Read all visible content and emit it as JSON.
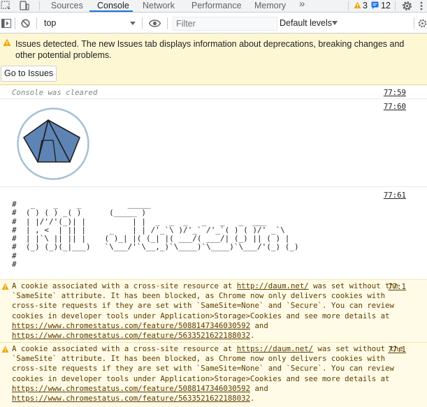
{
  "tabs": {
    "sources": "Sources",
    "console": "Console",
    "network": "Network",
    "performance": "Performance",
    "memory": "Memory",
    "more": "»"
  },
  "badges": {
    "warnings": "3",
    "messages": "12"
  },
  "toolbar": {
    "context": "top",
    "filter_placeholder": "Filter",
    "levels": "Default levels"
  },
  "banner": {
    "message": "Issues detected. The new Issues tab displays information about deprecations, breaking changes and other potential problems.",
    "button": "Go to Issues"
  },
  "logs": {
    "cleared": "Console was cleared",
    "cleared_ts": "77:59",
    "logo_ts": "77:60",
    "ascii_ts": "77:61",
    "ascii_art": "#   _    _    _          _____\n#  ( ) ( ) _( )      (_____ )\n#  | |/'/'(_)| |          | |  _  _  _   _   _   _  ___\n#  | , <  | || |     _    | | /'_`\\ )/'_` /'_`( ) ( )/' _`\\\n#  | |`\\ || || |    ( )_| |( (_| |( ___/( ___/| (_) || ( ) |\n#  (_) (_)(_|___)   `\\___/'`\\__,_)`\\____)`\\____)`\\___/'(_) (_)\n#\n#"
  },
  "warnings": [
    {
      "p1": "A cookie associated with a cross-site resource at ",
      "link1": "http://daum.net/",
      "p2": " was set without the `SameSite` attribute. It has been blocked, as Chrome now only delivers cookies with cross-site requests if they are set with `SameSite=None` and `Secure`. You can review cookies in developer tools under Application>Storage>Cookies and see more details at ",
      "link2": "https://www.chromestatus.com/feature/5088147346030592",
      "p3": " and ",
      "link3": "https://www.chromestatus.com/feature/5633521622188032",
      "p4": ".",
      "ts": "77:1"
    },
    {
      "p1": "A cookie associated with a cross-site resource at ",
      "link1": "https://daum.net/",
      "p2": " was set without the `SameSite` attribute. It has been blocked, as Chrome now only delivers cookies with cross-site requests if they are set with `SameSite=None` and `Secure`. You can review cookies in developer tools under Application>Storage>Cookies and see more details at ",
      "link2": "https://www.chromestatus.com/feature/5088147346030592",
      "p3": " and ",
      "link3": "https://www.chromestatus.com/feature/5633521622188032",
      "p4": ".",
      "ts": "77:1"
    }
  ]
}
